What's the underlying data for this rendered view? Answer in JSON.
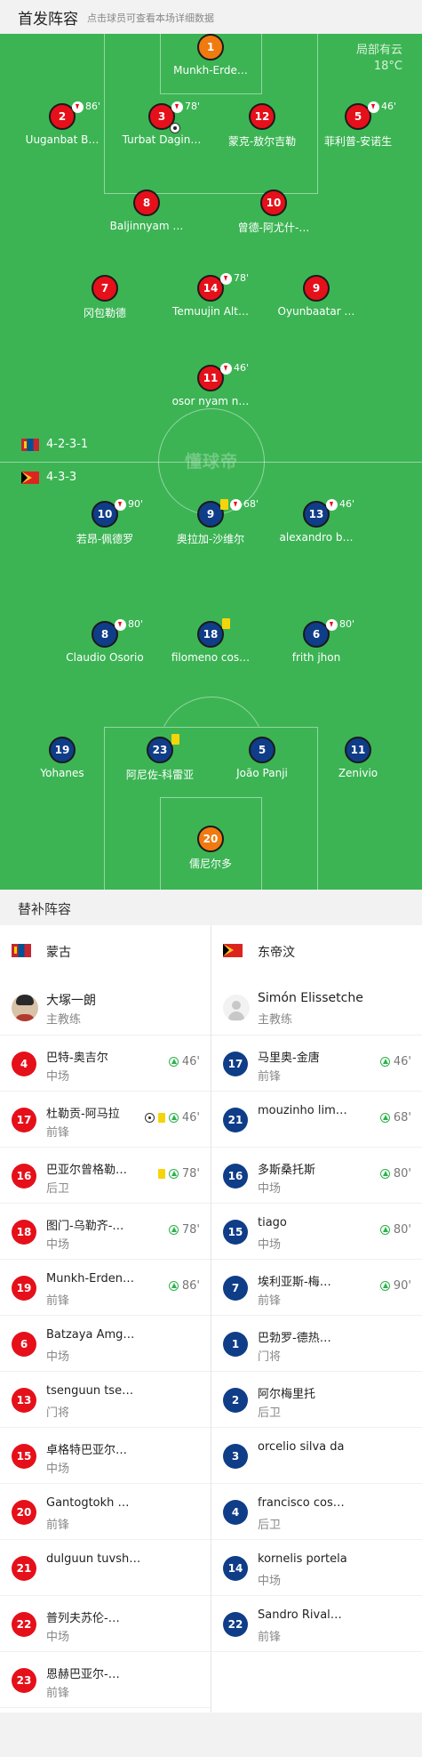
{
  "header": {
    "title": "首发阵容",
    "subtitle": "点击球员可查看本场详细数据"
  },
  "weather": {
    "condition": "局部有云",
    "temp": "18°C"
  },
  "watermark": "懂球帝",
  "home_formation": "4-2-3-1",
  "away_formation": "4-3-3",
  "home_players": [
    {
      "num": "1",
      "name": "Munkh-Erde…",
      "color": "orange"
    },
    {
      "num": "2",
      "name": "Uuganbat B…",
      "sub": "86'"
    },
    {
      "num": "3",
      "name": "Turbat Dagin…",
      "sub": "78'",
      "goal": true
    },
    {
      "num": "12",
      "name": "蒙克-敖尔吉勒"
    },
    {
      "num": "5",
      "name": "菲利普-安诺生",
      "sub": "46'"
    },
    {
      "num": "8",
      "name": "Baljinnyam …"
    },
    {
      "num": "10",
      "name": "曾德-阿尤什-…"
    },
    {
      "num": "7",
      "name": "冈包勒德"
    },
    {
      "num": "14",
      "name": "Temuujin Alt…",
      "sub": "78'"
    },
    {
      "num": "9",
      "name": "Oyunbaatar …"
    },
    {
      "num": "11",
      "name": "osor nyam n…",
      "sub": "46'"
    }
  ],
  "away_players": [
    {
      "num": "10",
      "name": "若昂-佩德罗",
      "sub": "90'"
    },
    {
      "num": "9",
      "name": "奥拉加-沙维尔",
      "sub": "68'",
      "yellow": true
    },
    {
      "num": "13",
      "name": "alexandro b…",
      "sub": "46'"
    },
    {
      "num": "8",
      "name": "Claudio Osorio",
      "sub": "80'"
    },
    {
      "num": "18",
      "name": "filomeno cos…",
      "yellow": true
    },
    {
      "num": "6",
      "name": "frith jhon",
      "sub": "80'"
    },
    {
      "num": "19",
      "name": "Yohanes"
    },
    {
      "num": "23",
      "name": "阿尼佐-科雷亚",
      "yellow": true
    },
    {
      "num": "5",
      "name": "João Panji"
    },
    {
      "num": "11",
      "name": "Zenivio"
    },
    {
      "num": "20",
      "name": "儒尼尔多",
      "color": "orange"
    }
  ],
  "subs_header": "替补阵容",
  "home": {
    "team": "蒙古",
    "coach": {
      "name": "大塚一朗",
      "role": "主教练"
    },
    "subs": [
      {
        "num": "4",
        "name": "巴特-奥吉尔",
        "pos": "中场",
        "in": "46'"
      },
      {
        "num": "17",
        "name": "杜勒贡-阿马拉",
        "pos": "前锋",
        "in": "46'",
        "goal": true,
        "yellow": true
      },
      {
        "num": "16",
        "name": "巴亚尔曾格勒…",
        "pos": "后卫",
        "in": "78'",
        "yellow": true
      },
      {
        "num": "18",
        "name": "图门-乌勒齐-…",
        "pos": "中场",
        "in": "78'"
      },
      {
        "num": "19",
        "name": "Munkh-Erden…",
        "pos": "前锋",
        "in": "86'"
      },
      {
        "num": "6",
        "name": "Batzaya Amg…",
        "pos": "中场"
      },
      {
        "num": "13",
        "name": "tsenguun tse…",
        "pos": "门将"
      },
      {
        "num": "15",
        "name": "卓格特巴亚尔…",
        "pos": "中场"
      },
      {
        "num": "20",
        "name": "Gantogtokh …",
        "pos": "前锋"
      },
      {
        "num": "21",
        "name": "dulguun tuvsh…",
        "pos": ""
      },
      {
        "num": "22",
        "name": "普列夫苏伦-…",
        "pos": "中场"
      },
      {
        "num": "23",
        "name": "恩赫巴亚尔-…",
        "pos": "前锋"
      }
    ]
  },
  "away": {
    "team": "东帝汶",
    "coach": {
      "name": "Simón Elissetche",
      "role": "主教练"
    },
    "subs": [
      {
        "num": "17",
        "name": "马里奥-金唐",
        "pos": "前锋",
        "in": "46'"
      },
      {
        "num": "21",
        "name": "mouzinho lim…",
        "pos": "",
        "in": "68'"
      },
      {
        "num": "16",
        "name": "多斯桑托斯",
        "pos": "中场",
        "in": "80'"
      },
      {
        "num": "15",
        "name": "tiago",
        "pos": "中场",
        "in": "80'"
      },
      {
        "num": "7",
        "name": "埃利亚斯-梅…",
        "pos": "前锋",
        "in": "90'"
      },
      {
        "num": "1",
        "name": "巴勃罗-德热…",
        "pos": "门将"
      },
      {
        "num": "2",
        "name": "阿尔梅里托",
        "pos": "后卫"
      },
      {
        "num": "3",
        "name": "orcelio silva da",
        "pos": ""
      },
      {
        "num": "4",
        "name": "francisco cos…",
        "pos": "后卫"
      },
      {
        "num": "14",
        "name": "kornelis portela",
        "pos": "中场"
      },
      {
        "num": "22",
        "name": "Sandro Rival…",
        "pos": "前锋"
      }
    ]
  },
  "colors": {
    "pitch": "#3cb454",
    "home": "#e5101a",
    "away": "#0f3d88",
    "keeper": "#f07a10",
    "sub_in": "#2db34a"
  }
}
